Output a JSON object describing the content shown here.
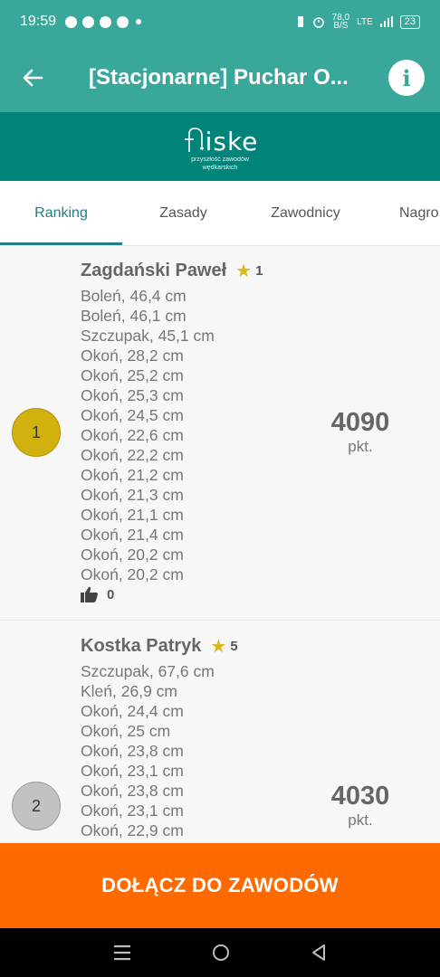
{
  "status": {
    "time": "19:59",
    "net_speed": "78,0",
    "net_unit": "B/S",
    "network": "LTE",
    "battery": "23"
  },
  "appbar": {
    "title": "[Stacjonarne] Puchar O...",
    "back_icon": "arrow-left-icon",
    "info_icon": "info-icon"
  },
  "brand": {
    "logo_text": "iske",
    "tagline_1": "przyszłość zawodów",
    "tagline_2": "wędkarskich"
  },
  "tabs": [
    {
      "label": "Ranking",
      "active": true
    },
    {
      "label": "Zasady",
      "active": false
    },
    {
      "label": "Zawodnicy",
      "active": false
    },
    {
      "label": "Nagro",
      "active": false
    }
  ],
  "ranking": [
    {
      "position": "1",
      "name": "Zagdański Paweł",
      "stars": "1",
      "catches": [
        "Boleń, 46,4 cm",
        "Boleń, 46,1 cm",
        "Szczupak, 45,1 cm",
        "Okoń, 28,2 cm",
        "Okoń, 25,2 cm",
        "Okoń, 25,3 cm",
        "Okoń, 24,5 cm",
        "Okoń, 22,6 cm",
        "Okoń, 22,2 cm",
        "Okoń, 21,2 cm",
        "Okoń, 21,3 cm",
        "Okoń, 21,1 cm",
        "Okoń, 21,4 cm",
        "Okoń, 20,2 cm",
        "Okoń, 20,2 cm"
      ],
      "likes": "0",
      "score": "4090",
      "unit": "pkt.",
      "color": "#d0b10d"
    },
    {
      "position": "2",
      "name": "Kostka Patryk",
      "stars": "5",
      "catches": [
        "Szczupak, 67,6 cm",
        "Kleń, 26,9 cm",
        "Okoń, 24,4 cm",
        "Okoń, 25 cm",
        "Okoń, 23,8 cm",
        "Okoń, 23,1 cm",
        "Okoń, 23,8 cm",
        "Okoń, 23,1 cm",
        "Okoń, 22,9 cm"
      ],
      "score": "4030",
      "unit": "pkt.",
      "color": "#c2c2c2"
    }
  ],
  "join_button": "DOŁĄCZ DO ZAWODÓW",
  "colors": {
    "primary": "#3aa79b",
    "brand_bar": "#008479",
    "accent": "#fe6a00",
    "tab_active": "#1f7f8a"
  }
}
